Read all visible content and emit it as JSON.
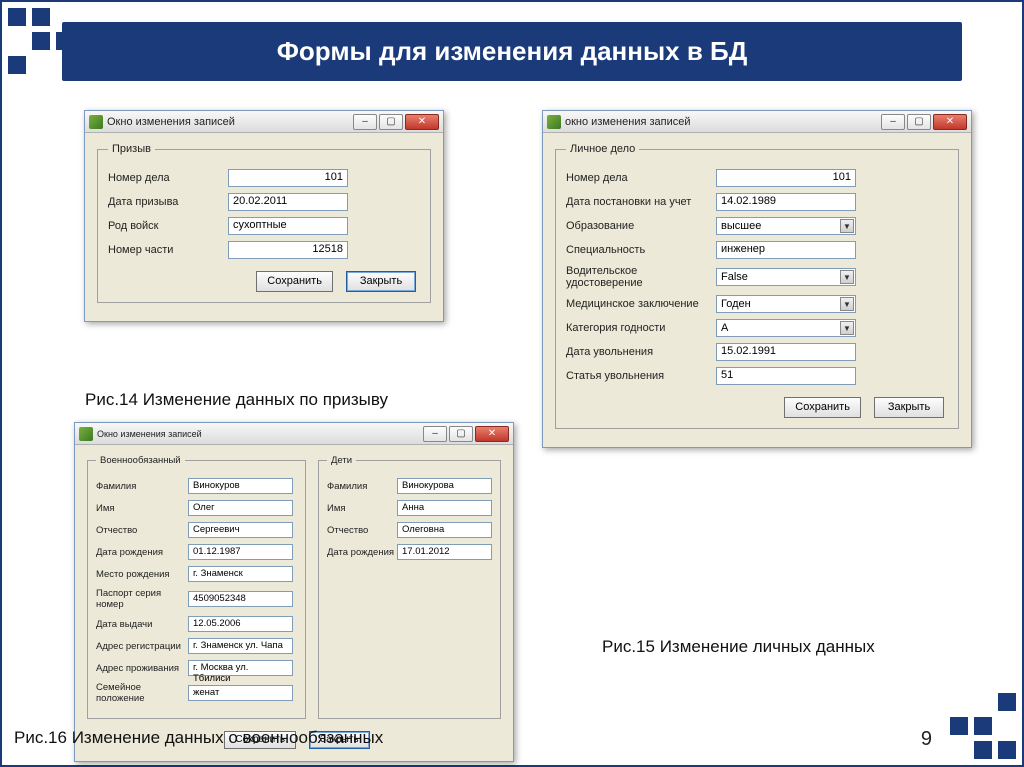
{
  "slide": {
    "title": "Формы для изменения данных в БД",
    "page": "9"
  },
  "captions": {
    "c14": "Рис.14 Изменение  данных по призыву",
    "c15": "Рис.15 Изменение личных данных",
    "c16": "Рис.16 Изменение  данных о военнообязанных"
  },
  "win1": {
    "title": "Окно изменения записей",
    "group": "Призыв",
    "fields": {
      "num_label": "Номер дела",
      "num_val": "101",
      "date_label": "Дата призыва",
      "date_val": "20.02.2011",
      "troop_label": "Род войск",
      "troop_val": "сухоптные",
      "unit_label": "Номер части",
      "unit_val": "12518"
    },
    "save": "Сохранить",
    "close": "Закрыть"
  },
  "win2": {
    "title": "окно изменения записей",
    "group": "Личное дело",
    "fields": {
      "num_label": "Номер дела",
      "num_val": "101",
      "reg_label": "Дата постановки на учет",
      "reg_val": "14.02.1989",
      "edu_label": "Образование",
      "edu_val": "высшее",
      "spec_label": "Специальность",
      "spec_val": "инженер",
      "lic_label": "Водительское удостоверение",
      "lic_val": "False",
      "med_label": "Медицинское заключение",
      "med_val": "Годен",
      "cat_label": "Категория годности",
      "cat_val": "А",
      "dis_label": "Дата увольнения",
      "dis_val": "15.02.1991",
      "art_label": "Статья увольнения",
      "art_val": "51"
    },
    "save": "Сохранить",
    "close": "Закрыть"
  },
  "win3": {
    "title": "Окно изменения записей",
    "group1": "Военнообязанный",
    "group2": "Дети",
    "p": {
      "fam_l": "Фамилия",
      "fam_v": "Винокуров",
      "name_l": "Имя",
      "name_v": "Олег",
      "patr_l": "Отчество",
      "patr_v": "Сергеевич",
      "bd_l": "Дата рождения",
      "bd_v": "01.12.1987",
      "bpl_l": "Место рождения",
      "bpl_v": "г. Знаменск",
      "pass_l": "Паспорт серия номер",
      "pass_v": "4509052348",
      "pd_l": "Дата выдачи",
      "pd_v": "12.05.2006",
      "reg_l": "Адрес регистрации",
      "reg_v": "г. Знаменск ул. Чапа",
      "liv_l": "Адрес проживания",
      "liv_v": "г. Москва ул. Тбилиси",
      "mar_l": "Семейное положение",
      "mar_v": "женат"
    },
    "c": {
      "fam_l": "Фамилия",
      "fam_v": "Винокурова",
      "name_l": "Имя",
      "name_v": "Анна",
      "patr_l": "Отчество",
      "patr_v": "Олеговна",
      "bd_l": "Дата рождения",
      "bd_v": "17.01.2012"
    },
    "save": "Сохранить",
    "close": "Закрыть"
  }
}
